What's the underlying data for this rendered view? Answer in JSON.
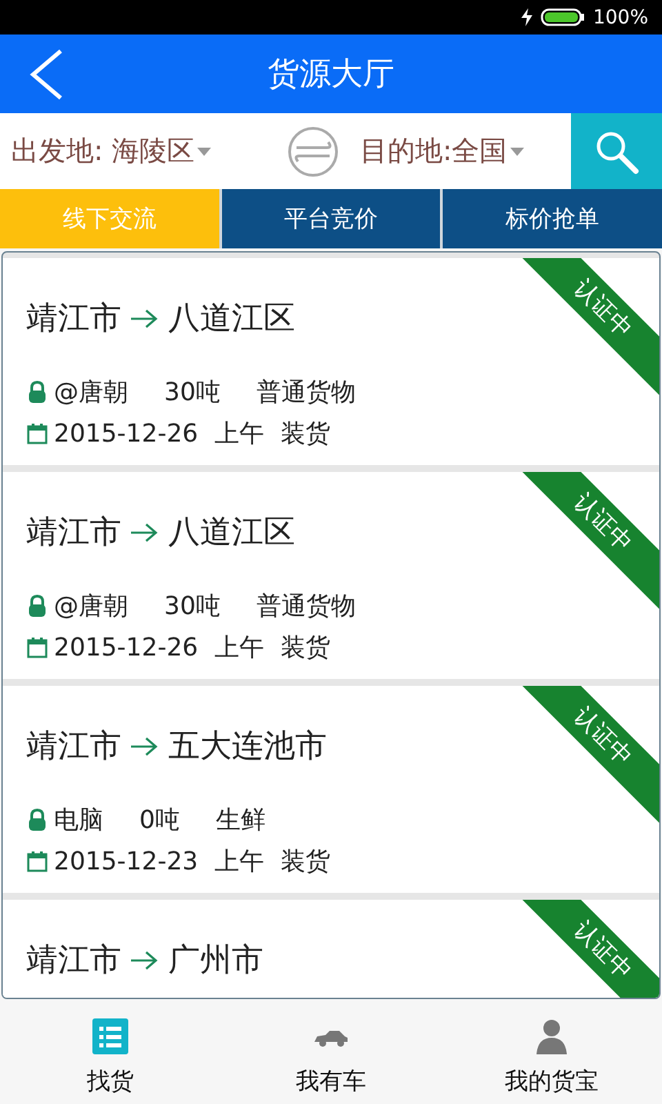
{
  "status_bar": {
    "battery": "100%"
  },
  "header": {
    "title": "货源大厅"
  },
  "filter": {
    "origin": "出发地: 海陵区",
    "destination": "目的地:全国"
  },
  "tabs": [
    {
      "label": "线下交流",
      "selected": true
    },
    {
      "label": "平台竞价",
      "selected": false
    },
    {
      "label": "标价抢单",
      "selected": false
    }
  ],
  "listings": [
    {
      "from": "靖江市",
      "to": "八道江区",
      "badge": "认证中",
      "owner": "@唐朝",
      "weight": "30吨",
      "cargo": "普通货物",
      "date": "2015-12-26",
      "time": "上午",
      "action": "装货"
    },
    {
      "from": "靖江市",
      "to": "八道江区",
      "badge": "认证中",
      "owner": "@唐朝",
      "weight": "30吨",
      "cargo": "普通货物",
      "date": "2015-12-26",
      "time": "上午",
      "action": "装货"
    },
    {
      "from": "靖江市",
      "to": "五大连池市",
      "badge": "认证中",
      "owner": "电脑",
      "weight": "0吨",
      "cargo": "生鲜",
      "date": "2015-12-23",
      "time": "上午",
      "action": "装货"
    },
    {
      "from": "靖江市",
      "to": "广州市",
      "badge": "认证中"
    }
  ],
  "bottom_nav": [
    {
      "label": "找货",
      "kind": "list",
      "selected": true
    },
    {
      "label": "我有车",
      "kind": "car",
      "selected": false
    },
    {
      "label": "我的货宝",
      "kind": "person",
      "selected": false
    }
  ]
}
